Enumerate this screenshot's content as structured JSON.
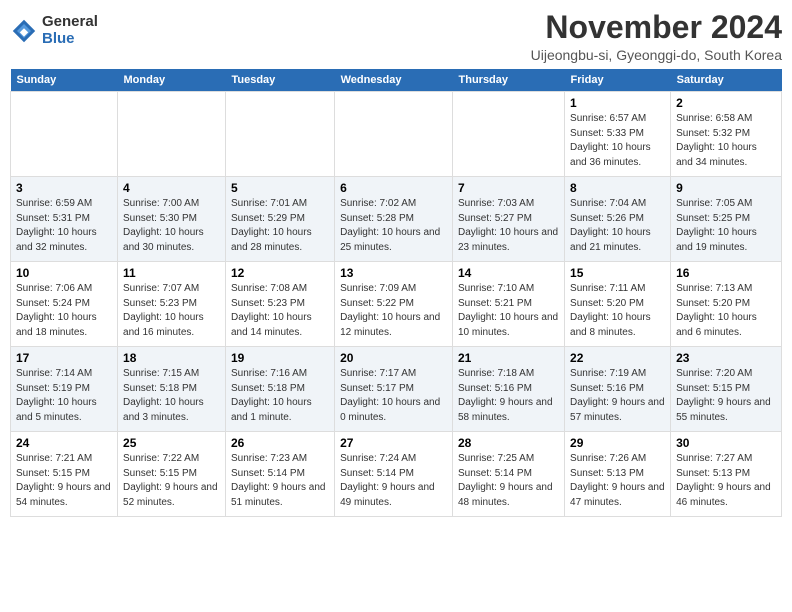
{
  "logo": {
    "general": "General",
    "blue": "Blue"
  },
  "title": {
    "month_year": "November 2024",
    "location": "Uijeongbu-si, Gyeonggi-do, South Korea"
  },
  "headers": [
    "Sunday",
    "Monday",
    "Tuesday",
    "Wednesday",
    "Thursday",
    "Friday",
    "Saturday"
  ],
  "weeks": [
    [
      {
        "day": "",
        "content": ""
      },
      {
        "day": "",
        "content": ""
      },
      {
        "day": "",
        "content": ""
      },
      {
        "day": "",
        "content": ""
      },
      {
        "day": "",
        "content": ""
      },
      {
        "day": "1",
        "content": "Sunrise: 6:57 AM\nSunset: 5:33 PM\nDaylight: 10 hours and 36 minutes."
      },
      {
        "day": "2",
        "content": "Sunrise: 6:58 AM\nSunset: 5:32 PM\nDaylight: 10 hours and 34 minutes."
      }
    ],
    [
      {
        "day": "3",
        "content": "Sunrise: 6:59 AM\nSunset: 5:31 PM\nDaylight: 10 hours and 32 minutes."
      },
      {
        "day": "4",
        "content": "Sunrise: 7:00 AM\nSunset: 5:30 PM\nDaylight: 10 hours and 30 minutes."
      },
      {
        "day": "5",
        "content": "Sunrise: 7:01 AM\nSunset: 5:29 PM\nDaylight: 10 hours and 28 minutes."
      },
      {
        "day": "6",
        "content": "Sunrise: 7:02 AM\nSunset: 5:28 PM\nDaylight: 10 hours and 25 minutes."
      },
      {
        "day": "7",
        "content": "Sunrise: 7:03 AM\nSunset: 5:27 PM\nDaylight: 10 hours and 23 minutes."
      },
      {
        "day": "8",
        "content": "Sunrise: 7:04 AM\nSunset: 5:26 PM\nDaylight: 10 hours and 21 minutes."
      },
      {
        "day": "9",
        "content": "Sunrise: 7:05 AM\nSunset: 5:25 PM\nDaylight: 10 hours and 19 minutes."
      }
    ],
    [
      {
        "day": "10",
        "content": "Sunrise: 7:06 AM\nSunset: 5:24 PM\nDaylight: 10 hours and 18 minutes."
      },
      {
        "day": "11",
        "content": "Sunrise: 7:07 AM\nSunset: 5:23 PM\nDaylight: 10 hours and 16 minutes."
      },
      {
        "day": "12",
        "content": "Sunrise: 7:08 AM\nSunset: 5:23 PM\nDaylight: 10 hours and 14 minutes."
      },
      {
        "day": "13",
        "content": "Sunrise: 7:09 AM\nSunset: 5:22 PM\nDaylight: 10 hours and 12 minutes."
      },
      {
        "day": "14",
        "content": "Sunrise: 7:10 AM\nSunset: 5:21 PM\nDaylight: 10 hours and 10 minutes."
      },
      {
        "day": "15",
        "content": "Sunrise: 7:11 AM\nSunset: 5:20 PM\nDaylight: 10 hours and 8 minutes."
      },
      {
        "day": "16",
        "content": "Sunrise: 7:13 AM\nSunset: 5:20 PM\nDaylight: 10 hours and 6 minutes."
      }
    ],
    [
      {
        "day": "17",
        "content": "Sunrise: 7:14 AM\nSunset: 5:19 PM\nDaylight: 10 hours and 5 minutes."
      },
      {
        "day": "18",
        "content": "Sunrise: 7:15 AM\nSunset: 5:18 PM\nDaylight: 10 hours and 3 minutes."
      },
      {
        "day": "19",
        "content": "Sunrise: 7:16 AM\nSunset: 5:18 PM\nDaylight: 10 hours and 1 minute."
      },
      {
        "day": "20",
        "content": "Sunrise: 7:17 AM\nSunset: 5:17 PM\nDaylight: 10 hours and 0 minutes."
      },
      {
        "day": "21",
        "content": "Sunrise: 7:18 AM\nSunset: 5:16 PM\nDaylight: 9 hours and 58 minutes."
      },
      {
        "day": "22",
        "content": "Sunrise: 7:19 AM\nSunset: 5:16 PM\nDaylight: 9 hours and 57 minutes."
      },
      {
        "day": "23",
        "content": "Sunrise: 7:20 AM\nSunset: 5:15 PM\nDaylight: 9 hours and 55 minutes."
      }
    ],
    [
      {
        "day": "24",
        "content": "Sunrise: 7:21 AM\nSunset: 5:15 PM\nDaylight: 9 hours and 54 minutes."
      },
      {
        "day": "25",
        "content": "Sunrise: 7:22 AM\nSunset: 5:15 PM\nDaylight: 9 hours and 52 minutes."
      },
      {
        "day": "26",
        "content": "Sunrise: 7:23 AM\nSunset: 5:14 PM\nDaylight: 9 hours and 51 minutes."
      },
      {
        "day": "27",
        "content": "Sunrise: 7:24 AM\nSunset: 5:14 PM\nDaylight: 9 hours and 49 minutes."
      },
      {
        "day": "28",
        "content": "Sunrise: 7:25 AM\nSunset: 5:14 PM\nDaylight: 9 hours and 48 minutes."
      },
      {
        "day": "29",
        "content": "Sunrise: 7:26 AM\nSunset: 5:13 PM\nDaylight: 9 hours and 47 minutes."
      },
      {
        "day": "30",
        "content": "Sunrise: 7:27 AM\nSunset: 5:13 PM\nDaylight: 9 hours and 46 minutes."
      }
    ]
  ]
}
